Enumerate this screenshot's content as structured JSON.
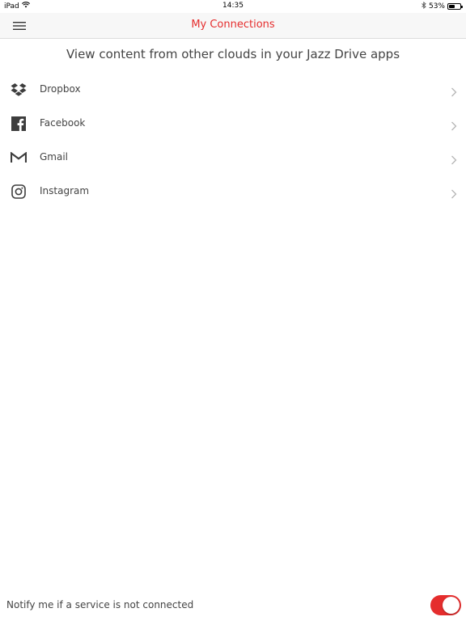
{
  "status_bar": {
    "device": "iPad",
    "time": "14:35",
    "battery_percent_label": "53%",
    "battery_level": 0.53,
    "icons": [
      "wifi-icon",
      "bluetooth-icon",
      "battery-icon"
    ]
  },
  "header": {
    "title": "My Connections",
    "menu_icon": "hamburger-menu-icon"
  },
  "subtitle": "View content from other clouds in your Jazz Drive apps",
  "connections": [
    {
      "label": "Dropbox",
      "icon": "dropbox-icon"
    },
    {
      "label": "Facebook",
      "icon": "facebook-icon"
    },
    {
      "label": "Gmail",
      "icon": "gmail-icon"
    },
    {
      "label": "Instagram",
      "icon": "instagram-icon"
    }
  ],
  "footer": {
    "notify_label": "Notify me if a service is not connected",
    "notify_enabled": true
  },
  "colors": {
    "accent": "#e52d2d",
    "text": "#444444",
    "navbar_bg": "#f7f7f7"
  }
}
